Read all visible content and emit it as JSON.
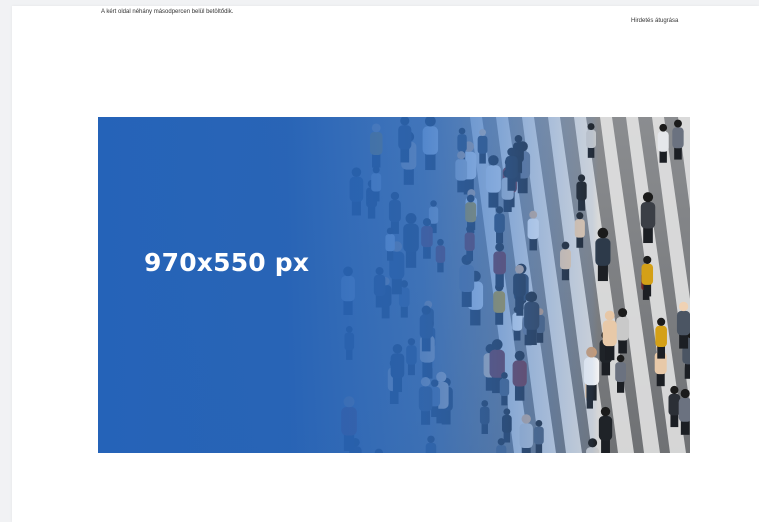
{
  "page": {
    "loading_message": "A kért oldal néhány másodpercen belül betöltődik.",
    "skip_ad_label": "Hirdetés átugrása"
  },
  "ad": {
    "size_label": "970x550 px",
    "photo_description": "crowd of pedestrians crossing a zebra crosswalk",
    "colors": {
      "brand_blue": "#2563b8",
      "road": "#7d7f82",
      "stripe": "#e8e8e8"
    }
  }
}
